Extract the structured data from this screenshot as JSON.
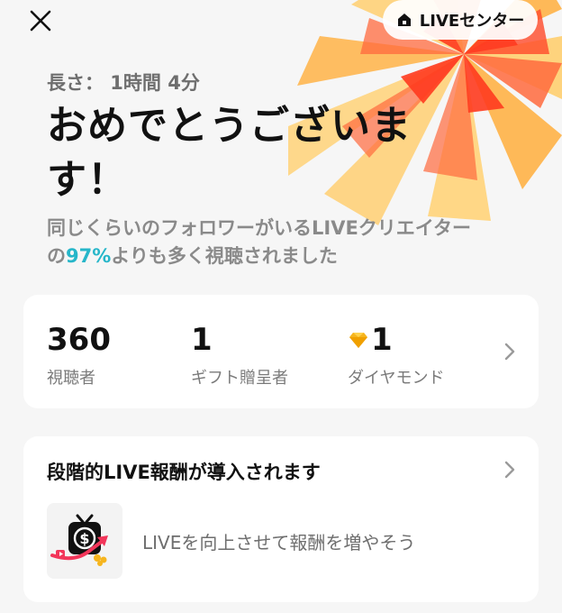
{
  "header": {
    "close_icon": "close-icon",
    "live_center_label": "LIVEセンター",
    "live_center_icon": "house-icon"
  },
  "summary": {
    "duration": "長さ： 1時間 4分",
    "congrats_line1": "おめでとうございま",
    "congrats_line2": "す！",
    "subtitle_line1": "同じくらいのフォロワーがいるLIVEクリエイター",
    "subtitle_prefix": "の",
    "subtitle_pct": "97%",
    "subtitle_suffix": "よりも多く視聴されました"
  },
  "stats": {
    "items": [
      {
        "value": "360",
        "label": "視聴者"
      },
      {
        "value": "1",
        "label": "ギフト贈呈者"
      },
      {
        "value": "1",
        "label": "ダイヤモンド",
        "icon": "diamond-icon"
      }
    ]
  },
  "rewards": {
    "title": "段階的LIVE報酬が導入されます",
    "promo_text": "LIVEを向上させて報酬を増やそう",
    "promo_icon": "money-tv-icon"
  },
  "colors": {
    "accent_percent": "#26b6c9",
    "burst_red": "#ff3b1f",
    "burst_orange": "#ffb347",
    "burst_yellow": "#ffd87a"
  }
}
